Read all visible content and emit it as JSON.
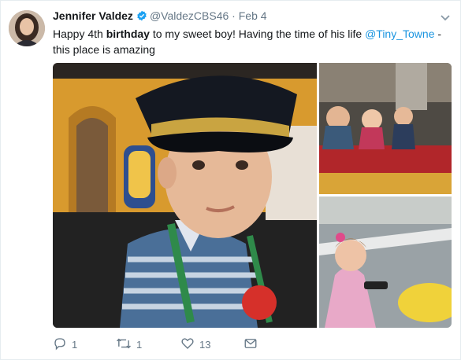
{
  "tweet": {
    "author_name": "Jennifer Valdez",
    "handle": "@ValdezCBS46",
    "separator": "·",
    "date": "Feb 4",
    "text_part1": "Happy 4th ",
    "text_bold": "birthday",
    "text_part2": " to my sweet boy! Having the time of his life ",
    "mention": "@Tiny_Towne",
    "text_part3": " - this place is amazing"
  },
  "actions": {
    "reply_count": "1",
    "retweet_count": "1",
    "like_count": "13"
  },
  "colors": {
    "link": "#1b95e0",
    "verified": "#1da1f2",
    "muted": "#657786"
  },
  "icons": [
    "chevron-down-icon",
    "verified-badge-icon",
    "reply-icon",
    "retweet-icon",
    "like-icon",
    "message-icon"
  ]
}
